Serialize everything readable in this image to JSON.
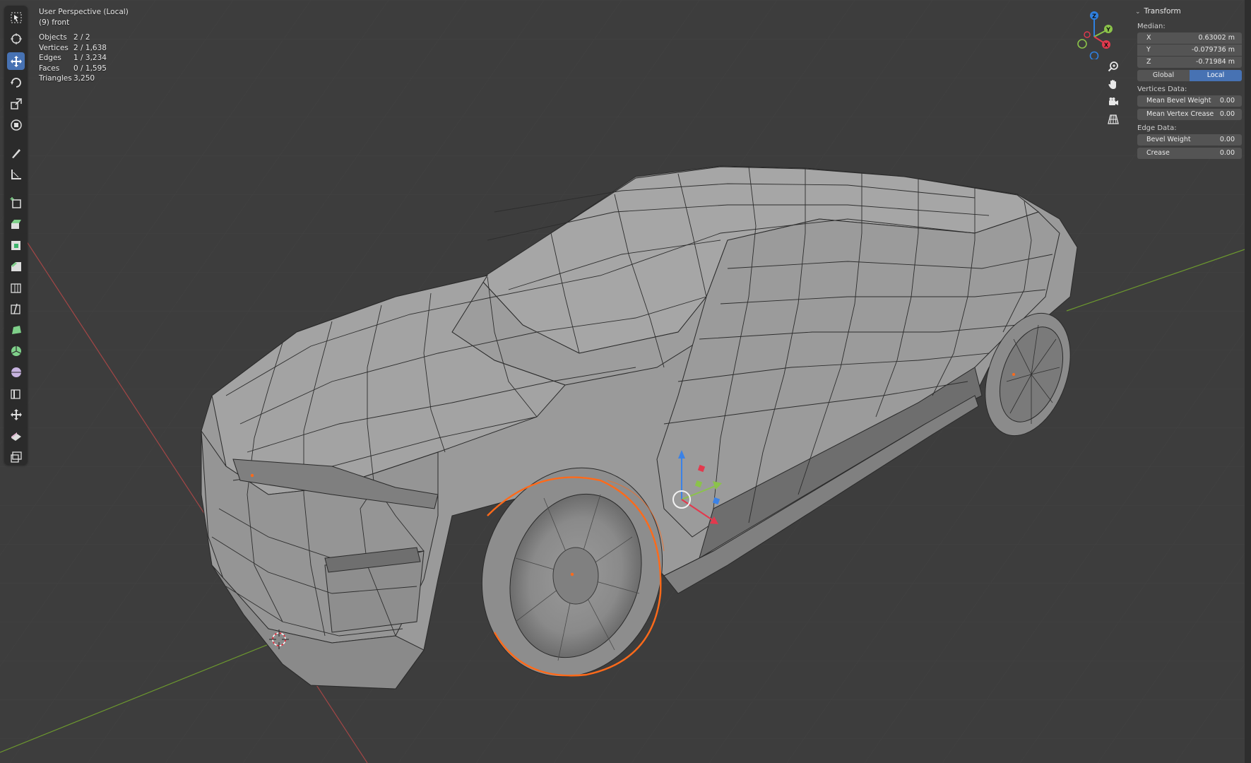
{
  "viewport_header": {
    "view_name": "User Perspective (Local)",
    "object_name": "(9) front"
  },
  "statistics": [
    {
      "label": "Objects",
      "value": "2 / 2"
    },
    {
      "label": "Vertices",
      "value": "2 / 1,638"
    },
    {
      "label": "Edges",
      "value": "1 / 3,234"
    },
    {
      "label": "Faces",
      "value": "0 / 1,595"
    },
    {
      "label": "Triangles",
      "value": "3,250"
    }
  ],
  "gizmo": {
    "axes": {
      "x": "X",
      "y": "Y",
      "z": "Z"
    },
    "colors": {
      "x": "#e3394d",
      "y": "#8bc34a",
      "z": "#2f80e0"
    }
  },
  "toolbar": {
    "active_tool": "move",
    "tools": [
      "select-box",
      "cursor",
      "move",
      "rotate",
      "scale",
      "transform",
      "annotate",
      "measure",
      "add-cube",
      "extrude-region",
      "inset-faces",
      "bevel",
      "loop-cut",
      "knife",
      "poly-build",
      "spin",
      "smooth",
      "edge-slide",
      "shrink-fatten",
      "shear",
      "rip-region"
    ]
  },
  "sidebar": {
    "panel_title": "Transform",
    "median_label": "Median:",
    "median": [
      {
        "axis": "X",
        "value": "0.63002 m"
      },
      {
        "axis": "Y",
        "value": "-0.079736 m"
      },
      {
        "axis": "Z",
        "value": "-0.71984 m"
      }
    ],
    "space_options": [
      "Global",
      "Local"
    ],
    "space_selected": "Local",
    "vertices_data_label": "Vertices Data:",
    "vertices_data": [
      {
        "label": "Mean Bevel Weight",
        "value": "0.00"
      },
      {
        "label": "Mean Vertex Crease",
        "value": "0.00"
      }
    ],
    "edge_data_label": "Edge Data:",
    "edge_data": [
      {
        "label": "Bevel Weight",
        "value": "0.00"
      },
      {
        "label": "Crease",
        "value": "0.00"
      }
    ]
  },
  "colors": {
    "background": "#3d3d3d",
    "accent": "#4772b3",
    "selection": "#ff6a1a",
    "x_axis_line": "#b04545",
    "y_axis_line": "#6d9a2e"
  }
}
